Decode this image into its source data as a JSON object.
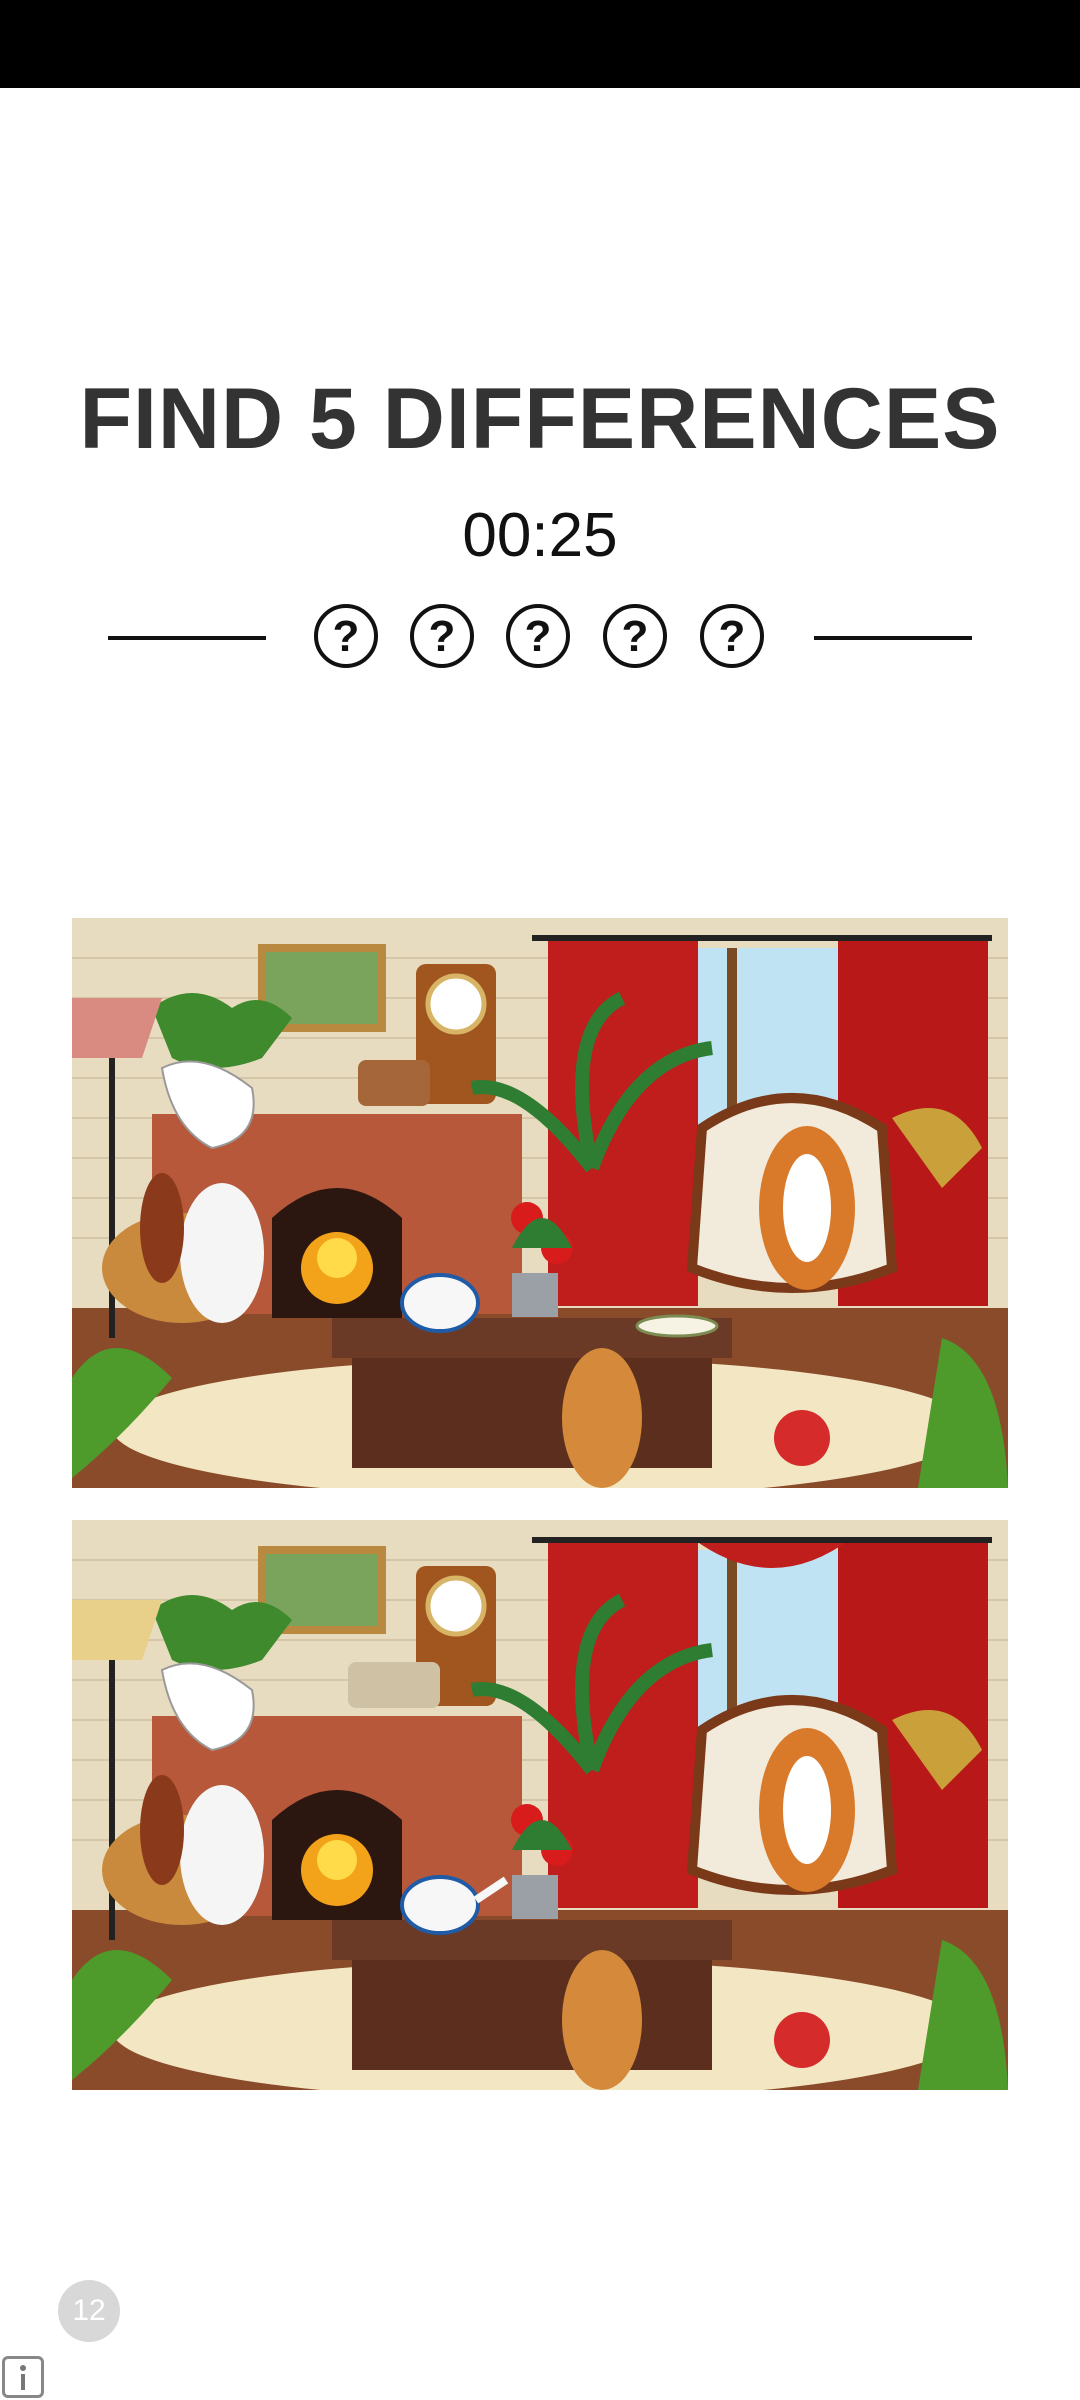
{
  "game": {
    "title": "FIND 5 DIFFERENCES",
    "timer": "00:25",
    "hint_slots": [
      "?",
      "?",
      "?",
      "?",
      "?"
    ]
  },
  "scenes": [
    {
      "id": "top",
      "lamp_shade_color": "#d98b82",
      "radio_color": "#a5663a",
      "curtain_valance": false,
      "teapot_spout": false,
      "plate_visible": true
    },
    {
      "id": "bottom",
      "lamp_shade_color": "#e8cf8a",
      "radio_color": "#cfc1a3",
      "curtain_valance": true,
      "teapot_spout": true,
      "plate_visible": false
    }
  ],
  "footer": {
    "ad_badge": "12"
  },
  "icons": [
    "pointing-hand-icon",
    "info-icon"
  ]
}
